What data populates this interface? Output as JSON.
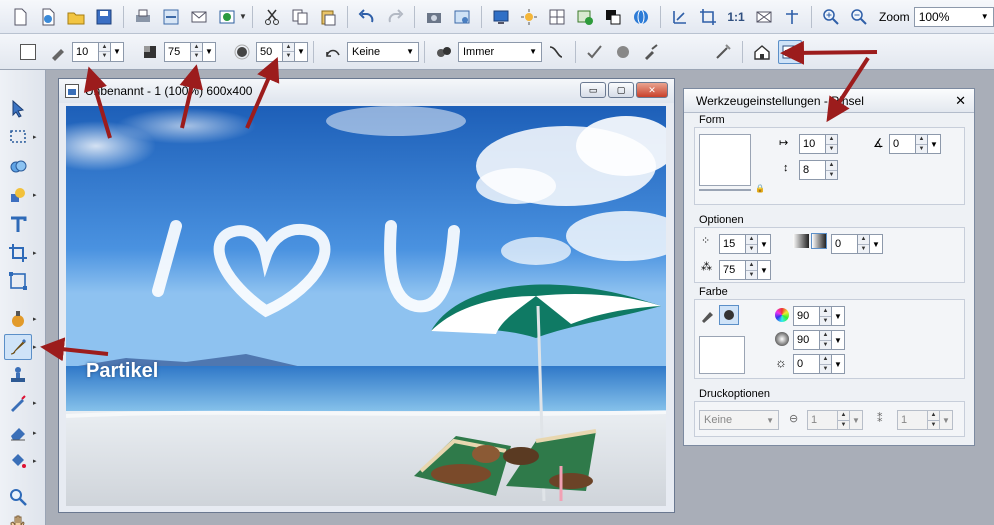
{
  "toolbar": {
    "zoom_label": "Zoom",
    "zoom_value": "100%",
    "icons": [
      "new-file-icon",
      "open-globe-icon",
      "open-folder-icon",
      "save-icon",
      "print-icon",
      "scan-icon",
      "email-icon",
      "browser-icon",
      "cut-icon",
      "copy-icon",
      "paste-icon",
      "undo-icon",
      "redo-icon",
      "camera-icon",
      "photo-settings-icon",
      "screen-icon",
      "brightness-icon",
      "grid-icon",
      "image-refresh-icon",
      "color-icon",
      "globe-icon",
      "resize-icon",
      "crop-icon",
      "actual-size-icon",
      "envelope-icon",
      "align-icon",
      "zoom-in-icon",
      "zoom-out-icon"
    ],
    "actual_size_label": "1:1"
  },
  "options_bar": {
    "size_value": "10",
    "opacity_value": "75",
    "softness_value": "50",
    "blend_value": "Keine",
    "mode_value": "Immer"
  },
  "image_window": {
    "title": "Unbenannt - 1 (100%) 600x400",
    "min_label": "▭",
    "max_label": "▢",
    "close_label": "✕"
  },
  "panel": {
    "title": "Werkzeugeinstellungen - Pinsel",
    "close_label": "✕",
    "form": {
      "label": "Form",
      "width_value": "10",
      "height_value": "8",
      "angle_value": "0"
    },
    "optionen": {
      "label": "Optionen",
      "density_value": "15",
      "gradient_value": "0",
      "flow_value": "75"
    },
    "farbe": {
      "label": "Farbe",
      "hue_value": "90",
      "saturation_value": "90",
      "brightness_value": "0"
    },
    "druckoptionen": {
      "label": "Druckoptionen",
      "mode_value": "Keine",
      "value_a": "1",
      "value_b": "1"
    }
  },
  "annotation": {
    "label": "Partikel"
  },
  "colors": {
    "accent": "#9c1c1c",
    "sky_top": "#1d5fb8",
    "sea": "#2f78c8"
  }
}
